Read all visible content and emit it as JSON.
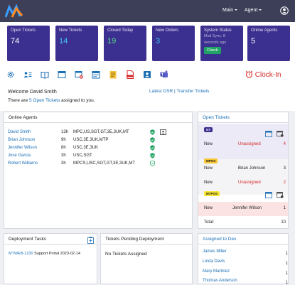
{
  "header": {
    "logo": "company-logo",
    "main_menu": "Main",
    "agent_menu": "Agent",
    "user_icon": "user-circle-icon"
  },
  "tiles": [
    {
      "label": "Open Tickets",
      "value": "74"
    },
    {
      "label": "New Tickets",
      "value": "14"
    },
    {
      "label": "Closed Today",
      "value": "19"
    },
    {
      "label": "New Orders",
      "value": "3"
    },
    {
      "label": "System Status",
      "sub1": "Mail Sync: 8",
      "sub2": "seconds ago",
      "button": "Check"
    },
    {
      "label": "Online Agents",
      "value": "5"
    }
  ],
  "toolbar": {
    "icons": [
      "gear-icon",
      "user-list-icon",
      "book-icon",
      "browser-window-icon",
      "window-close-icon",
      "calendar-icon",
      "notes-icon",
      "html-file-icon",
      "contact-card-icon",
      "teams-icon"
    ],
    "clock_in": "Clock-In"
  },
  "welcome": {
    "greeting": "Welcome David Smith",
    "assigned_prefix": "There are ",
    "assigned_link": "5 Open Tickets",
    "assigned_suffix": " assigned to you.",
    "link_dsr": "Latest DSR",
    "link_sep": " | ",
    "link_transfer": "Transfer Tickets"
  },
  "online_agents": {
    "title": "Online Agents",
    "rows": [
      {
        "name": "David Smith",
        "hours": "13h",
        "skills": "MPC,US,SGT,GT,3E,3UK,MT"
      },
      {
        "name": "Brian Johnson",
        "hours": "9h",
        "skills": "USC,3E,3UK,MTP"
      },
      {
        "name": "Jennifer Wilson",
        "hours": "8h",
        "skills": "USC,3E,3UK"
      },
      {
        "name": "Jose Garcia",
        "hours": "3h",
        "skills": "USC,SGT"
      },
      {
        "name": "Robert Williams",
        "hours": "3h",
        "skills": "MPCS,USC,SGT,GT,3E,3UK,MT"
      }
    ]
  },
  "open_tickets": {
    "title": "Open Tickets",
    "groups": [
      {
        "badge": "GT",
        "status": "New",
        "assignee": "Unassigned",
        "count": "4"
      },
      {
        "badge": "MPOS",
        "status": "New",
        "assignee": "Brian Johnson",
        "count": "3"
      },
      {
        "badge": "",
        "status": "New",
        "assignee": "Unassigned",
        "count": "2"
      },
      {
        "badge": "MTPOS",
        "status": "New",
        "assignee": "Jennifer Wilson",
        "count": "1"
      }
    ],
    "total_label": "Total:",
    "total": "10"
  },
  "deployment_tasks": {
    "title": "Deployment Tasks",
    "rows": [
      {
        "id": "MTWEB-1230",
        "project": "Support Portal",
        "date": "2023-02-14"
      }
    ]
  },
  "tickets_pending": {
    "title": "Tickets Pending Deployment",
    "empty": "No Tickets Assigned"
  },
  "assigned_to_dev": {
    "title": "Assigned to Dev",
    "rows": [
      {
        "name": "James Miller",
        "count": "1"
      },
      {
        "name": "Linda Davis",
        "count": "1"
      },
      {
        "name": "Mary Martinez",
        "count": "1"
      },
      {
        "name": "Thomas Anderson",
        "count": "1"
      }
    ]
  },
  "colors": {
    "header_bg": "#3d3f58",
    "tile_bg": "#3b2f8f",
    "accent_blue": "#1a6fb5",
    "clockin_red": "#d62828",
    "unassigned_red": "#d62828"
  }
}
